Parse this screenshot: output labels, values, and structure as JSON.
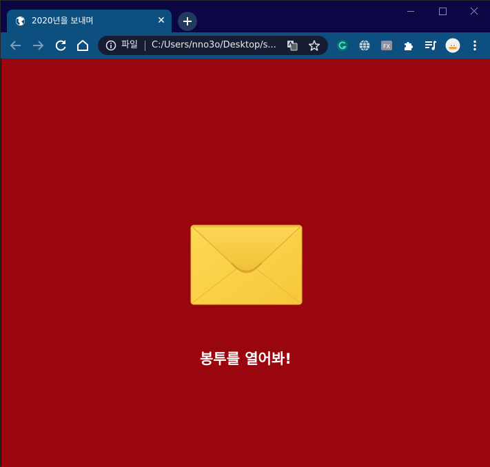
{
  "tab": {
    "title": "2020년을 보내며",
    "close_symbol": "✕",
    "favicon": "globe-icon"
  },
  "window_controls": [
    "minimize-icon",
    "maximize-icon",
    "close-icon"
  ],
  "toolbar": {
    "buttons": [
      "back-icon",
      "forward-icon",
      "reload-icon",
      "home-icon"
    ],
    "extensions": [
      "grammar-extension-icon",
      "globe-extension-icon",
      "fx-extension-icon",
      "puzzle-extensions-icon",
      "media-queue-icon",
      "profile-avatar"
    ]
  },
  "omnibox": {
    "scheme_label": "파일",
    "url": "C:/Users/nno3o/Desktop/s..."
  },
  "page": {
    "background_color": "#99060d",
    "envelope_icon": "envelope-icon",
    "caption": "봉투를 열어봐!"
  },
  "colors": {
    "titlebar": "#0c0645",
    "tab_active": "#0d4f7e",
    "omnibox": "#161d33",
    "envelope": "#fdd24a"
  }
}
